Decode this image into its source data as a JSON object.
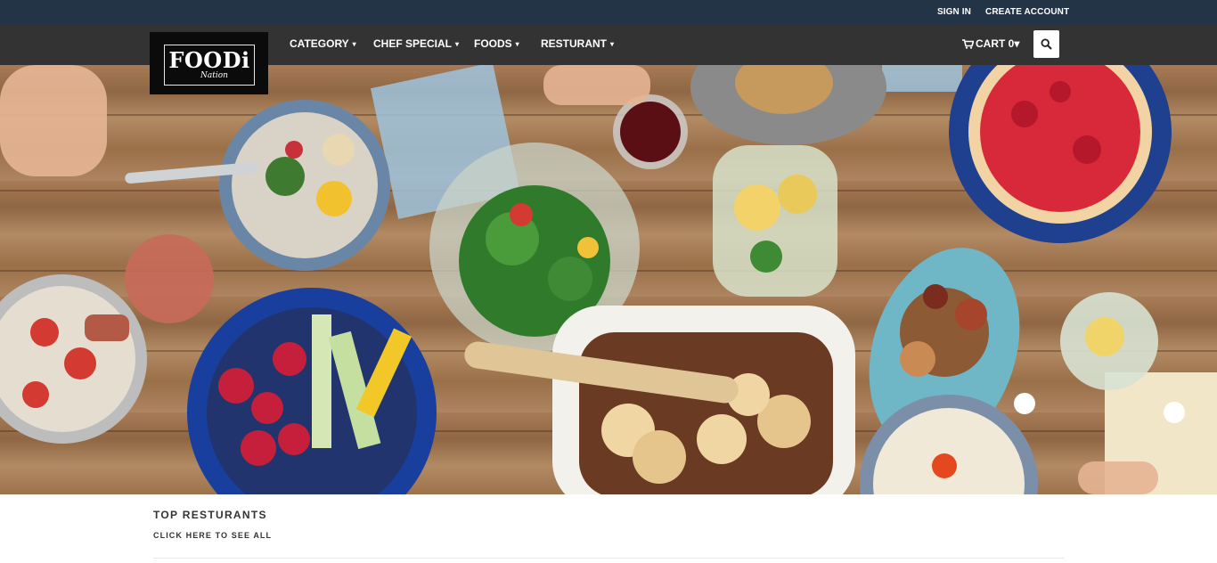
{
  "topbar": {
    "signin": "SIGN IN",
    "create_account": "CREATE ACCOUNT"
  },
  "logo": {
    "word": "FOODi",
    "sub": "Nation"
  },
  "nav": {
    "items": [
      {
        "label": "CATEGORY"
      },
      {
        "label": "CHEF SPECIAL"
      },
      {
        "label": "FOODS"
      },
      {
        "label": "RESTURANT"
      }
    ],
    "cart_label": "CART 0"
  },
  "section": {
    "title": "TOP RESTURANTS",
    "link": "CLICK HERE TO SEE ALL"
  },
  "colors": {
    "topbar": "#243447",
    "navbar": "#333333",
    "accent": "#c9a647"
  },
  "icons": [
    "cart-icon",
    "search-icon",
    "caret-down-icon"
  ]
}
